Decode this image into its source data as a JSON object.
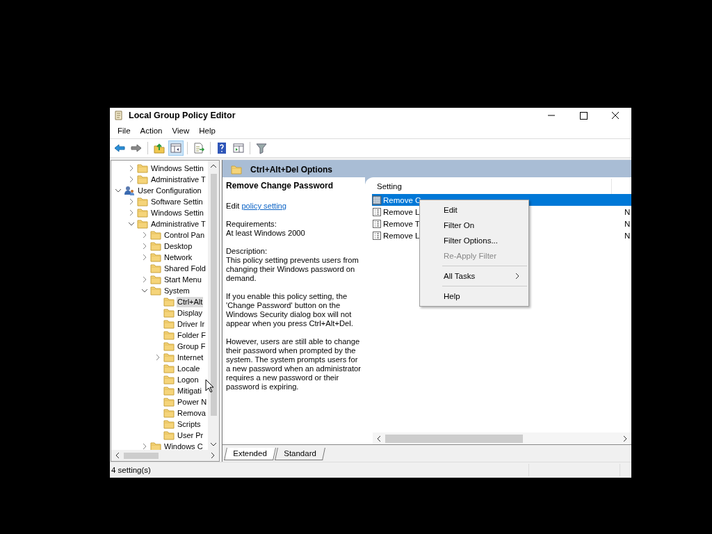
{
  "window": {
    "title": "Local Group Policy Editor"
  },
  "menu_bar": [
    "File",
    "Action",
    "View",
    "Help"
  ],
  "toolbar": [
    {
      "kind": "back"
    },
    {
      "kind": "forward"
    },
    {
      "kind": "sep"
    },
    {
      "kind": "up"
    },
    {
      "kind": "tree",
      "selected": true
    },
    {
      "kind": "sep"
    },
    {
      "kind": "export"
    },
    {
      "kind": "sep"
    },
    {
      "kind": "help"
    },
    {
      "kind": "panel"
    },
    {
      "kind": "sep"
    },
    {
      "kind": "filter"
    }
  ],
  "tree": {
    "orphan_items": [
      {
        "label": "Windows Settin",
        "kind": "folder",
        "expanded": false,
        "selected": false
      },
      {
        "label": "Administrative T",
        "kind": "folder",
        "expanded": false,
        "selected": false
      }
    ],
    "items": [
      {
        "label": "User Configuration",
        "kind": "user",
        "expanded": true,
        "selected": false,
        "children": [
          {
            "label": "Software Settin",
            "kind": "folder",
            "expanded": false,
            "selected": false
          },
          {
            "label": "Windows Settin",
            "kind": "folder",
            "expanded": false,
            "selected": false
          },
          {
            "label": "Administrative T",
            "kind": "folder",
            "expanded": true,
            "selected": false,
            "children": [
              {
                "label": "Control Pan",
                "kind": "folder",
                "expanded": false,
                "selected": false
              },
              {
                "label": "Desktop",
                "kind": "folder",
                "expanded": false,
                "selected": false
              },
              {
                "label": "Network",
                "kind": "folder",
                "expanded": false,
                "selected": false
              },
              {
                "label": "Shared Fold",
                "kind": "folder",
                "selected": false
              },
              {
                "label": "Start Menu",
                "kind": "folder",
                "expanded": false,
                "selected": false
              },
              {
                "label": "System",
                "kind": "folder",
                "expanded": true,
                "selected": false,
                "children": [
                  {
                    "label": "Ctrl+Alt",
                    "kind": "folder",
                    "selected": true
                  },
                  {
                    "label": "Display",
                    "kind": "folder",
                    "selected": false
                  },
                  {
                    "label": "Driver Ir",
                    "kind": "folder",
                    "selected": false
                  },
                  {
                    "label": "Folder F",
                    "kind": "folder",
                    "selected": false
                  },
                  {
                    "label": "Group F",
                    "kind": "folder",
                    "selected": false
                  },
                  {
                    "label": "Internet",
                    "kind": "folder",
                    "expanded": false,
                    "selected": false
                  },
                  {
                    "label": "Locale",
                    "kind": "folder",
                    "selected": false
                  },
                  {
                    "label": "Logon",
                    "kind": "folder",
                    "selected": false
                  },
                  {
                    "label": "Mitigati",
                    "kind": "folder",
                    "selected": false
                  },
                  {
                    "label": "Power N",
                    "kind": "folder",
                    "selected": false
                  },
                  {
                    "label": "Remova",
                    "kind": "folder",
                    "selected": false
                  },
                  {
                    "label": "Scripts",
                    "kind": "folder",
                    "selected": false
                  },
                  {
                    "label": "User Pr",
                    "kind": "folder",
                    "selected": false
                  }
                ]
              },
              {
                "label": "Windows C",
                "kind": "folder",
                "expanded": false,
                "selected": false
              }
            ]
          }
        ]
      }
    ]
  },
  "pane_header": "Ctrl+Alt+Del Options",
  "details": {
    "title": "Remove Change Password",
    "edit_prefix": "Edit",
    "edit_link": "policy setting",
    "requirements_label": "Requirements:",
    "requirements": "At least Windows 2000",
    "description_label": "Description:",
    "paragraphs": [
      "This policy setting prevents users from changing their Windows password on demand.",
      "If you enable this policy setting, the 'Change Password' button on the Windows Security dialog box will not appear when you press Ctrl+Alt+Del.",
      "However, users are still able to change their password when prompted by the system. The system prompts users for a new password when an administrator requires a new password or their password is expiring."
    ]
  },
  "table": {
    "columns": [
      "Setting"
    ],
    "rows": [
      {
        "setting": "Remove C",
        "selected": true,
        "kind": "active"
      },
      {
        "setting": "Remove L",
        "column_2": "N",
        "selected": false,
        "kind": "policy"
      },
      {
        "setting": "Remove T",
        "column_2": "N",
        "selected": false,
        "kind": "policy"
      },
      {
        "setting": "Remove L",
        "column_2": "N",
        "selected": false,
        "kind": "policy"
      }
    ]
  },
  "context_menu": [
    {
      "label": "Edit",
      "kind": "item",
      "disabled": false
    },
    {
      "label": "Filter On",
      "kind": "item",
      "disabled": false
    },
    {
      "label": "Filter Options...",
      "kind": "item",
      "disabled": false
    },
    {
      "label": "Re-Apply Filter",
      "kind": "item",
      "disabled": true
    },
    {
      "kind": "sep"
    },
    {
      "label": "All Tasks",
      "kind": "submenu",
      "disabled": false
    },
    {
      "kind": "sep"
    },
    {
      "label": "Help",
      "kind": "item",
      "disabled": false
    }
  ],
  "view_tabs": [
    {
      "label": "Extended",
      "selected": true
    },
    {
      "label": "Standard",
      "selected": false
    }
  ],
  "status_bar": "4 setting(s)"
}
